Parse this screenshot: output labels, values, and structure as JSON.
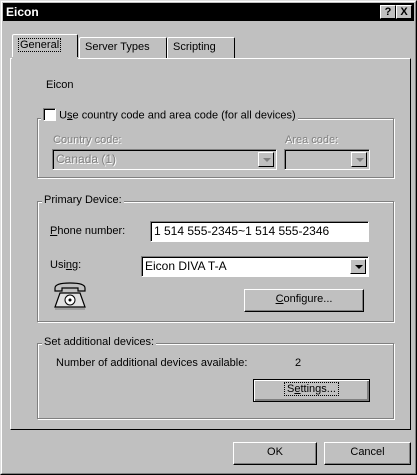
{
  "window": {
    "title": "Eicon",
    "help_label": "?",
    "close_label": "X"
  },
  "tabs": [
    {
      "label": "General",
      "active": true
    },
    {
      "label": "Server Types",
      "active": false
    },
    {
      "label": "Scripting",
      "active": false
    }
  ],
  "general": {
    "name": "Eicon",
    "area_code_checkbox": {
      "pre": "U",
      "accel": "s",
      "post": "e country code and area code (for all devices)",
      "checked": false
    },
    "country_code": {
      "label": "Country code:",
      "value": "Canada (1)"
    },
    "area_code": {
      "label": "Area code:",
      "value": ""
    },
    "primary_device": {
      "label": "Primary Device:",
      "phone_label": {
        "accel": "P",
        "rest": "hone number:"
      },
      "phone_value": "1 514 555-2345~1 514 555-2346",
      "using_label": {
        "pre": "Usi",
        "accel": "n",
        "post": "g:"
      },
      "using_value": "Eicon DIVA T-A",
      "configure_button": {
        "accel": "C",
        "rest": "onfigure..."
      }
    },
    "additional": {
      "label": "Set additional devices:",
      "count_text": "Number of additional devices available:",
      "count": "2",
      "settings_button": {
        "pre": "S",
        "accel": "e",
        "post": "ttings..."
      }
    }
  },
  "footer": {
    "ok_label": "OK",
    "cancel_label": "Cancel"
  },
  "icons": {
    "phone": "telephone-icon"
  }
}
